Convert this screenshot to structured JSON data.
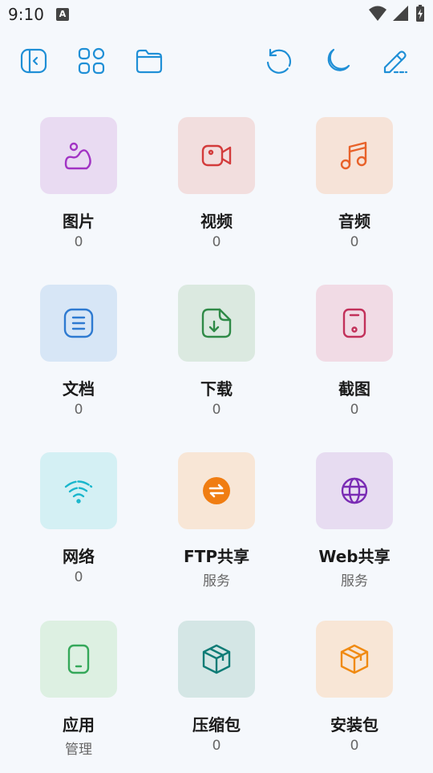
{
  "status": {
    "time": "9:10",
    "a_badge": "A"
  },
  "toolbar": {
    "icons": [
      "sidebar-toggle-icon",
      "grid-icon",
      "folder-icon",
      "refresh-icon",
      "moon-icon",
      "edit-icon"
    ]
  },
  "tiles": [
    {
      "label": "图片",
      "sub": "0",
      "bg": "#e9dbf2",
      "fg": "#a234c4",
      "icon": "image-icon"
    },
    {
      "label": "视频",
      "sub": "0",
      "bg": "#f2dede",
      "fg": "#d33b3b",
      "icon": "video-icon"
    },
    {
      "label": "音频",
      "sub": "0",
      "bg": "#f6e3d8",
      "fg": "#e8622a",
      "icon": "music-icon"
    },
    {
      "label": "文档",
      "sub": "0",
      "bg": "#d7e6f6",
      "fg": "#2e7ad1",
      "icon": "document-icon"
    },
    {
      "label": "下载",
      "sub": "0",
      "bg": "#dbe9e0",
      "fg": "#2f8a47",
      "icon": "download-icon"
    },
    {
      "label": "截图",
      "sub": "0",
      "bg": "#f1dbe5",
      "fg": "#c2305a",
      "icon": "screenshot-icon"
    },
    {
      "label": "网络",
      "sub": "0",
      "bg": "#d4f0f4",
      "fg": "#19b6cc",
      "icon": "wifi-icon"
    },
    {
      "label": "FTP共享",
      "sub": "服务",
      "bg": "#f8e6d6",
      "fg": "#f07d12",
      "icon": "transfer-icon"
    },
    {
      "label": "Web共享",
      "sub": "服务",
      "bg": "#e7dcf1",
      "fg": "#7a2bb4",
      "icon": "globe-icon"
    },
    {
      "label": "应用",
      "sub": "管理",
      "bg": "#ddf0e2",
      "fg": "#35a85a",
      "icon": "phone-icon"
    },
    {
      "label": "压缩包",
      "sub": "0",
      "bg": "#d4e6e5",
      "fg": "#0f7c76",
      "icon": "archive-icon"
    },
    {
      "label": "安装包",
      "sub": "0",
      "bg": "#f8e6d6",
      "fg": "#f08a12",
      "icon": "package-icon"
    }
  ]
}
